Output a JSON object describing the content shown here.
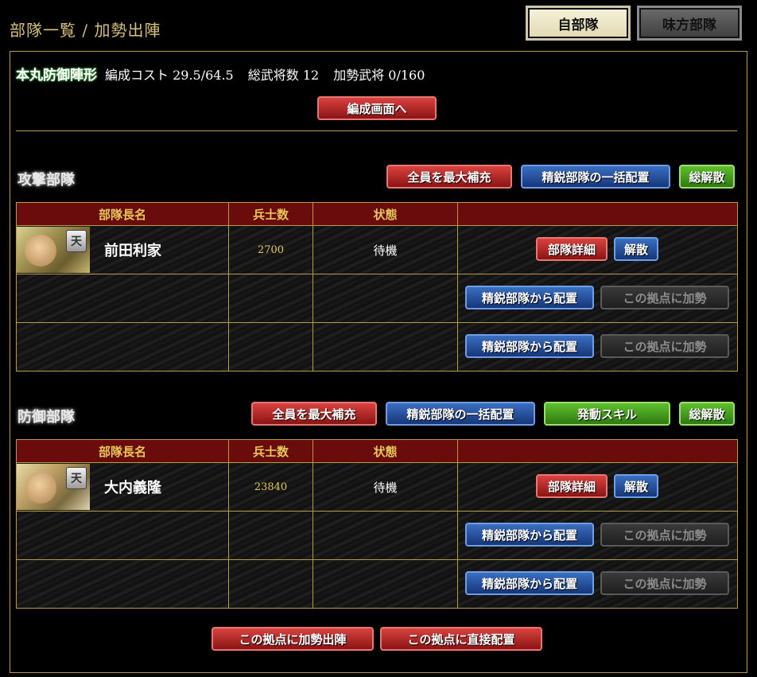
{
  "header": {
    "title": "部隊一覧 / 加勢出陣"
  },
  "tabs": {
    "own": "自部隊",
    "ally": "味方部隊"
  },
  "info": {
    "formation": "本丸防御陣形",
    "cost": "編成コスト 29.5/64.5",
    "total_generals": "総武将数 12",
    "reinforce": "加勢武将 0/160"
  },
  "buttons": {
    "edit_screen": "編成画面へ",
    "max_refill": "全員を最大補充",
    "elite_deploy_all": "精鋭部隊の一括配置",
    "disband_all": "総解散",
    "active_skill": "発動スキル",
    "unit_detail": "部隊詳細",
    "disband": "解散",
    "deploy_from_elite": "精鋭部隊から配置",
    "reinforce_here": "この拠点に加勢",
    "reinforce_sortie": "この拠点に加勢出陣",
    "direct_deploy": "この拠点に直接配置"
  },
  "table_headers": {
    "leader": "部隊長名",
    "soldiers": "兵士数",
    "status": "状態"
  },
  "attack": {
    "title": "攻撃部隊",
    "unit": {
      "leader": "前田利家",
      "rank": "天",
      "soldiers": "2700",
      "status": "待機"
    }
  },
  "defense": {
    "title": "防御部隊",
    "unit": {
      "leader": "大内義隆",
      "rank": "天",
      "soldiers": "23840",
      "status": "待機"
    }
  }
}
